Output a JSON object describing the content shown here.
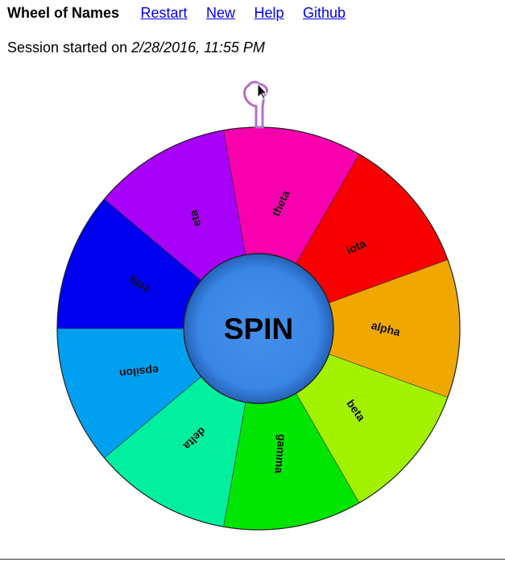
{
  "header": {
    "title": "Wheel of Names",
    "links": [
      "Restart",
      "New",
      "Help",
      "Github"
    ]
  },
  "session": {
    "prefix": "Session started on",
    "datetime": "2/28/2016, 11:55 PM"
  },
  "wheel": {
    "spin_label": "SPIN",
    "spin_color": "#3a86e6",
    "pointer_color": "#b070c8",
    "segments": [
      {
        "name": "alpha",
        "color": "#f0a800"
      },
      {
        "name": "beta",
        "color": "#a2f200"
      },
      {
        "name": "gamma",
        "color": "#00e600"
      },
      {
        "name": "delta",
        "color": "#00f0a0"
      },
      {
        "name": "epsilon",
        "color": "#00a0f0"
      },
      {
        "name": "zeta",
        "color": "#0000f0"
      },
      {
        "name": "eta",
        "color": "#a800f8"
      },
      {
        "name": "theta",
        "color": "#f800ae"
      },
      {
        "name": "iota",
        "color": "#f80000"
      }
    ]
  }
}
